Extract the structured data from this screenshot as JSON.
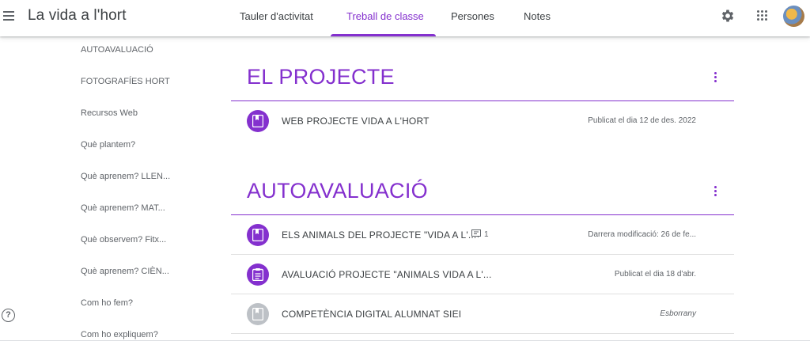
{
  "header": {
    "title": "La vida a l'hort",
    "tabs": [
      {
        "label": "Tauler d'activitat",
        "active": false
      },
      {
        "label": "Treball de classe",
        "active": true
      },
      {
        "label": "Persones",
        "active": false
      },
      {
        "label": "Notes",
        "active": false
      }
    ],
    "icons": [
      "menu-icon",
      "settings-gear-icon",
      "apps-grid-icon",
      "avatar"
    ],
    "accent_color": "#8430ce"
  },
  "sidebar": {
    "items": [
      {
        "label": "AUTOAVALUACIÓ"
      },
      {
        "label": "FOTOGRAFÍES HORT"
      },
      {
        "label": "Recursos Web"
      },
      {
        "label": "Què plantem?"
      },
      {
        "label": "Què aprenem? LLEN..."
      },
      {
        "label": "Què aprenem? MAT..."
      },
      {
        "label": "Què observem? Fitx..."
      },
      {
        "label": "Què aprenem? CIÈN..."
      },
      {
        "label": "Com ho fem?"
      },
      {
        "label": "Com ho expliquem?"
      }
    ],
    "help_label": "?"
  },
  "topics": [
    {
      "title": "EL PROJECTE",
      "items": [
        {
          "title": "WEB PROJECTE VIDA A L'HORT",
          "meta": "Publicat el dia 12 de des. 2022",
          "icon": "material-icon",
          "draft": false
        }
      ]
    },
    {
      "title": "AUTOAVALUACIÓ",
      "items": [
        {
          "title": "ELS ANIMALS DEL PROJECTE \"VIDA A L'...",
          "meta": "Darrera modificació: 26 de fe...",
          "comments": "1",
          "icon": "material-icon",
          "draft": false
        },
        {
          "title": "AVALUACIÓ PROJECTE \"ANIMALS VIDA A L'...",
          "meta": "Publicat el dia 18 d'abr.",
          "icon": "assignment-icon",
          "draft": false
        },
        {
          "title": "COMPETÈNCIA DIGITAL ALUMNAT SIEI",
          "meta": "Esborrany",
          "icon": "material-icon",
          "draft": true
        }
      ]
    }
  ]
}
